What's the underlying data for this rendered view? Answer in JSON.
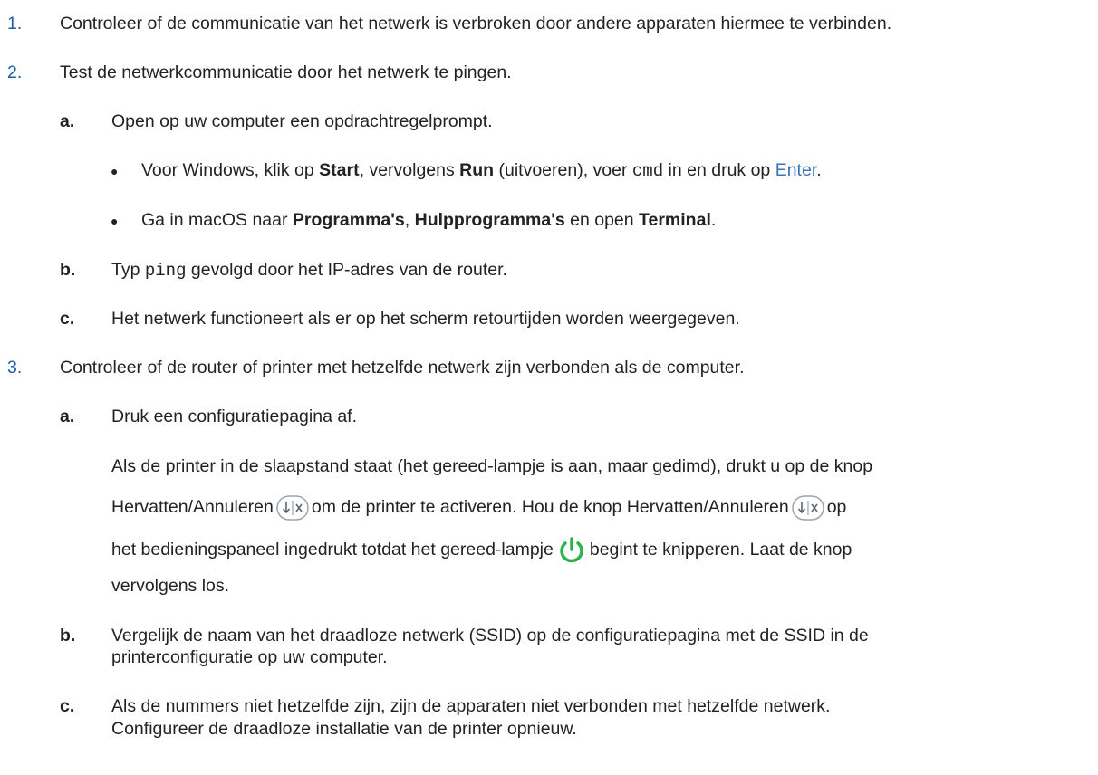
{
  "steps": [
    {
      "num": "1.",
      "text": "Controleer of de communicatie van het netwerk is verbroken door andere apparaten hiermee te verbinden."
    },
    {
      "num": "2.",
      "text": "Test de netwerkcommunicatie door het netwerk te pingen.",
      "sub": [
        {
          "letter": "a.",
          "text": "Open op uw computer een opdrachtregelprompt."
        },
        {
          "letter": "b.",
          "pre": "Typ ",
          "code": "ping",
          "post": " gevolgd door het IP-adres van de router."
        },
        {
          "letter": "c.",
          "text": "Het netwerk functioneert als er op het scherm retourtijden worden weergegeven."
        }
      ],
      "bullets": {
        "windows": {
          "t1": "Voor Windows, klik op ",
          "b1": "Start",
          "t2": ", vervolgens ",
          "b2": "Run",
          "t3": " (uitvoeren), voer ",
          "code": "cmd",
          "t4": " in en druk op ",
          "link": "Enter",
          "t5": "."
        },
        "mac": {
          "t1": "Ga in macOS naar ",
          "b1": "Programma's",
          "t2": ", ",
          "b2": "Hulpprogramma's",
          "t3": " en open ",
          "b3": "Terminal",
          "t4": "."
        }
      }
    },
    {
      "num": "3.",
      "text": "Controleer of de router of printer met hetzelfde netwerk zijn verbonden als de computer.",
      "sub": [
        {
          "letter": "a.",
          "text": "Druk een configuratiepagina af."
        },
        {
          "letter": "b.",
          "line1": "Vergelijk de naam van het draadloze netwerk (SSID) op de configuratiepagina met de SSID in de",
          "line2": "printerconfiguratie op uw computer."
        },
        {
          "letter": "c.",
          "line1": "Als de nummers niet hetzelfde zijn, zijn de apparaten niet verbonden met hetzelfde netwerk.",
          "line2": "Configureer de draadloze installatie van de printer opnieuw."
        }
      ],
      "para": {
        "l1": "Als de printer in de slaapstand staat (het gereed-lampje is aan, maar gedimd), drukt u op de knop",
        "l2a": "Hervatten/Annuleren",
        "l2b": "om de printer te activeren. Hou de knop Hervatten/Annuleren",
        "l2c": "op",
        "l3a": "het bedieningspaneel ingedrukt totdat het gereed-lampje",
        "l3b": "begint te knipperen. Laat de knop",
        "l4": "vervolgens los."
      }
    }
  ],
  "icons": {
    "resume_cancel": "resume-cancel-icon",
    "ready_light": "power-ready-icon",
    "ready_color": "#2bb24c"
  }
}
